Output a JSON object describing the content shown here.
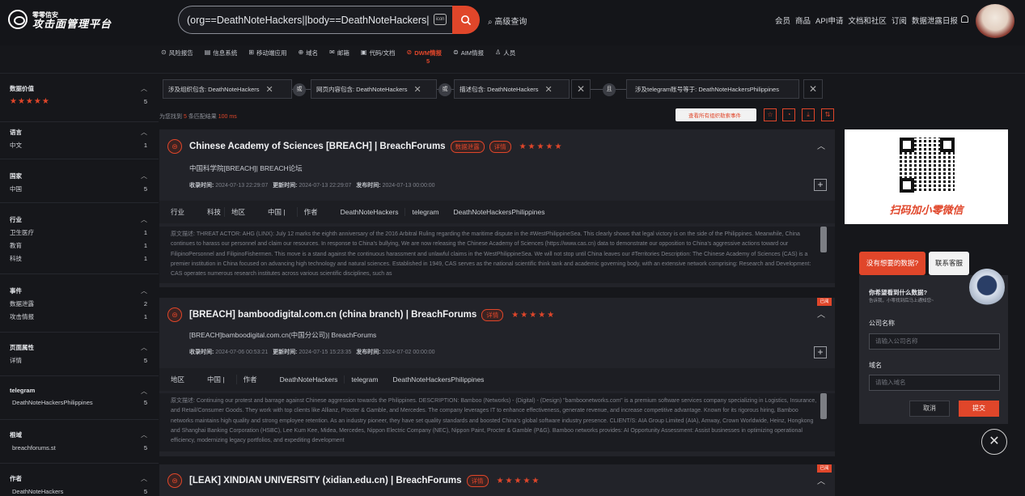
{
  "brand": {
    "line1": "零零信安",
    "line2": "攻击面管理平台"
  },
  "search": {
    "value": "(org==DeathNoteHackers||body==DeathNoteHackers||desc",
    "icon_label": "icon",
    "advanced": "高级查询"
  },
  "topnav": [
    "会员",
    "商品",
    "API申请",
    "文档和社区",
    "订阅",
    "数据泄露日报"
  ],
  "subnav": [
    {
      "label": "风险报告",
      "icon": "⊙"
    },
    {
      "label": "信息系统",
      "icon": "▤"
    },
    {
      "label": "移动端应用",
      "icon": "⊞"
    },
    {
      "label": "域名",
      "icon": "⊕"
    },
    {
      "label": "邮箱",
      "icon": "✉"
    },
    {
      "label": "代码/文档",
      "icon": "▣"
    },
    {
      "label": "DWM情报",
      "icon": "⊘",
      "count": "5"
    },
    {
      "label": "AIM情报",
      "icon": "⊜"
    },
    {
      "label": "人员",
      "icon": "♙"
    }
  ],
  "sidebar": {
    "value": {
      "title": "数据价值",
      "stars": "★★★★★",
      "count": "5"
    },
    "language": {
      "title": "语言",
      "items": [
        {
          "label": "中文",
          "count": "1"
        }
      ]
    },
    "country": {
      "title": "国家",
      "items": [
        {
          "label": "中国",
          "count": "5"
        }
      ]
    },
    "industry": {
      "title": "行业",
      "items": [
        {
          "label": "卫生医疗",
          "count": "1"
        },
        {
          "label": "教育",
          "count": "1"
        },
        {
          "label": "科技",
          "count": "1"
        }
      ]
    },
    "event": {
      "title": "事件",
      "items": [
        {
          "label": "数据泄露",
          "count": "2"
        },
        {
          "label": "攻击情报",
          "count": "1"
        }
      ]
    },
    "page_attr": {
      "title": "页面属性",
      "items": [
        {
          "label": "详情",
          "count": "5"
        }
      ]
    },
    "telegram": {
      "title": "telegram",
      "items": [
        {
          "label": "DeathNoteHackersPhilippines",
          "count": "5"
        }
      ]
    },
    "root_domain": {
      "title": "根域",
      "items": [
        {
          "label": "breachforums.st",
          "count": "5"
        }
      ]
    },
    "author": {
      "title": "作者",
      "items": [
        {
          "label": "DeathNoteHackers",
          "count": "5"
        }
      ]
    }
  },
  "filters": {
    "f1": "涉及组织包含: DeathNoteHackers",
    "op1": "或",
    "f2": "网页内容包含: DeathNoteHackers",
    "op2": "或",
    "f3": "描述包含: DeathNoteHackers",
    "op3": "且",
    "f4": "涉及telegram账号等于: DeathNoteHackersPhilippines"
  },
  "results": {
    "prefix": "为您找到",
    "count": "5",
    "mid": "条匹配结果",
    "time": "100 ms"
  },
  "event_button": "查看所有组织勒索事件",
  "cards": [
    {
      "title": "Chinese Academy of Sciences [BREACH] | BreachForums",
      "tags": [
        "数据泄露",
        "详情"
      ],
      "stars": "★★★★★",
      "subtitle": "中国科学院[BREACH]| BREACH论坛",
      "collect_label": "收录时间:",
      "collect": "2024-07-13 22:29:07",
      "update_label": "更新时间:",
      "update": "2024-07-13 22:29:07",
      "publish_label": "发布时间:",
      "publish": "2024-07-13 00:00:00",
      "kv": [
        [
          "行业",
          "科技"
        ],
        [
          "地区",
          "中国 |"
        ],
        [
          "作者",
          "DeathNoteHackers"
        ],
        [
          "telegram",
          "DeathNoteHackersPhilippines"
        ]
      ],
      "desc": "原文描述:   THREAT ACTOR: AHG (LINX): July 12 marks the eighth anniversary of the 2016 Arbitral Ruling regarding the maritime dispute in the #WestPhilippineSea. This clearly shows that legal victory is on the side of the Philippines. Meanwhile, China continues to harass our personnel and claim our resources. In response to China's bullying, We are now releasing the Chinese Academy of Sciences (https://www.cas.cn) data to demonstrate our opposition to China's aggressive actions toward our FilipinoPersonnel and FilipinoFishermen. This move is a stand against the continuous harassment and unlawful claims in the WestPhilippineSea. We will not stop until China leaves our #Territories Description: The Chinese Academy of Sciences (CAS) is a premier institution in China focused on advancing high technology and natural sciences. Established in 1949, CAS serves as the national scientific think tank and academic governing body, with an extensive network comprising: Research and Development: CAS operates numerous research institutes across various scientific disciplines, such as"
    },
    {
      "badge": "已阅",
      "title": "[BREACH] bamboodigital.com.cn (china branch) | BreachForums",
      "tags": [
        "详情"
      ],
      "stars": "★★★★★",
      "subtitle": "[BREACH]bamboodigital.com.cn(中国分公司)| BreachForums",
      "collect_label": "收录时间:",
      "collect": "2024-07-06 00:53:21",
      "update_label": "更新时间:",
      "update": "2024-07-15 15:23:35",
      "publish_label": "发布时间:",
      "publish": "2024-07-02 00:00:00",
      "kv": [
        [
          "地区",
          "中国 |"
        ],
        [
          "作者",
          "DeathNoteHackers"
        ],
        [
          "telegram",
          "DeathNoteHackersPhilippines"
        ]
      ],
      "desc": "原文描述:   Continuing our protest and barrage against Chinese aggression towards the Philippines. DESCRIPTION: Bamboo (Networks) - (Digital) - (Design) \"bamboonetworks.com\" is a premium software services company specializing in Logistics, Insurance, and Retail/Consumer Goods. They work with top clients like Allianz, Procter & Gamble, and Mercedes. The company leverages IT to enhance effectiveness, generate revenue, and increase competitive advantage. Known for its rigorous hiring, Bamboo networks maintains high quality and strong employee retention. As an industry pioneer, they have set quality standards and boosted China's global software industry presence. CLIENT/S: AIA Group Limited (AIA), Amway, Crown Worldwide, Heinz, Hongkong and Shanghai Banking Corporation (HSBC), Lee Kum Kee, Midea, Mercedes, Nippon Electric Company (NEC), Nippon Paint, Procter & Gamble (P&G). Bamboo networks provides: AI Opportunity Assessment: Assist businesses in optimizing operational efficiency, modernizing legacy portfolios, and expediting development"
    },
    {
      "badge": "已阅",
      "title": "[LEAK] XINDIAN UNIVERSITY (xidian.edu.cn) | BreachForums",
      "tags": [
        "详情"
      ],
      "stars": "★★★★★"
    }
  ],
  "qr": {
    "caption": "扫码加小零微信"
  },
  "widget": {
    "ask": "没有想要的数据?",
    "service": "联系客服",
    "q": "你希望看到什么数据?",
    "q_sub": "告诉我，小零找到后马上通知您~",
    "company_label": "公司名称",
    "company_placeholder": "请输入公司名称",
    "domain_label": "域名",
    "domain_placeholder": "请输入域名",
    "cancel": "取消",
    "submit": "提交"
  },
  "colors": {
    "accent": "#e0462a",
    "bg": "#16171b",
    "card": "#222329"
  }
}
